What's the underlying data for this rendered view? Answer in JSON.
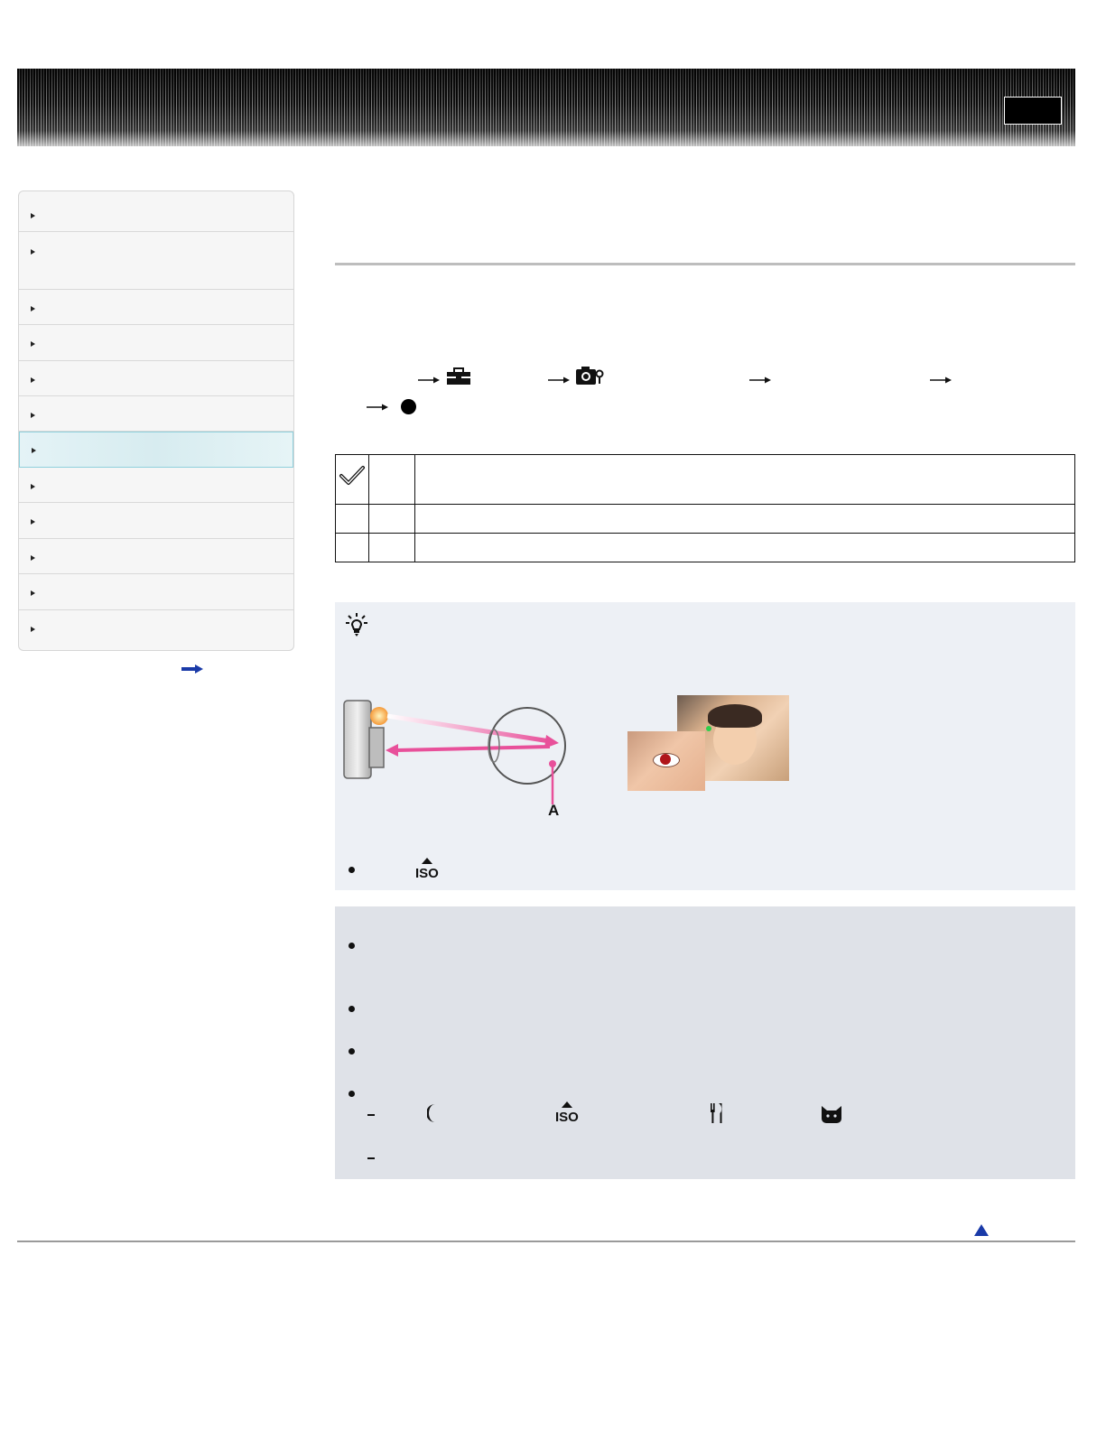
{
  "header": {
    "button_label": ""
  },
  "sidebar": {
    "items": [
      {
        "label": ""
      },
      {
        "label": ""
      },
      {
        "label": ""
      },
      {
        "label": ""
      },
      {
        "label": ""
      },
      {
        "label": ""
      },
      {
        "label": "",
        "active": true
      },
      {
        "label": ""
      },
      {
        "label": ""
      },
      {
        "label": ""
      },
      {
        "label": ""
      },
      {
        "label": ""
      }
    ],
    "more_icon": "right-arrow-icon"
  },
  "main": {
    "menu_path_icons": [
      "arrow-icon",
      "toolbox-icon",
      "arrow-icon",
      "camera-settings-icon",
      "arrow-icon",
      "arrow-icon",
      "arrow-icon",
      "filled-circle-icon"
    ],
    "options_table": {
      "rows": [
        {
          "icon": "checkmark-icon",
          "label": "",
          "desc": ""
        },
        {
          "icon": "",
          "label": "",
          "desc": ""
        },
        {
          "icon": "",
          "label": "",
          "desc": ""
        }
      ]
    },
    "hint": {
      "icon": "lightbulb-icon",
      "diagram_label": "A",
      "bullet_icon": "high-sensitivity-iso-icon"
    },
    "notes": {
      "icons": [
        "twilight-moon-icon",
        "high-sensitivity-iso-icon",
        "gourmet-fork-knife-icon",
        "pet-cat-icon"
      ]
    }
  },
  "colors": {
    "accent": "#e8509a",
    "link_blue": "#1a3aa8",
    "hint_bg": "#edf0f5",
    "notes_bg": "#dfe2e8"
  }
}
